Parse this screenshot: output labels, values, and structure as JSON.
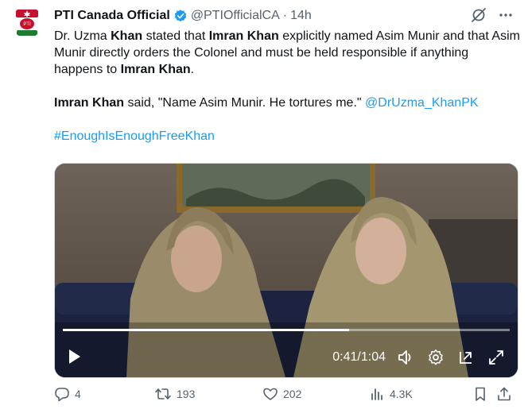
{
  "account": {
    "name": "PTI Canada Official",
    "handle": "@PTIOfficialCA",
    "separator": "·",
    "time": "14h",
    "avatar_text": "PTI Canada"
  },
  "tweet": {
    "p1": {
      "t1": "Dr. Uzma ",
      "t2": "Khan",
      "t3": " stated that ",
      "t4": "Imran Khan",
      "t5": " explicitly named Asim Munir and that Asim Munir directly orders the Colonel and must be held responsible if anything happens to ",
      "t6": "Imran Khan",
      "t7": "."
    },
    "p2": {
      "t1": "Imran Khan",
      "t2": " said, \"Name Asim Munir. He tortures me.\" ",
      "mention": "@DrUzma_KhanPK"
    },
    "p3": {
      "hashtag": "#EnoughIsEnoughFreeKhan"
    }
  },
  "video": {
    "current_time": "0:41",
    "separator": "/",
    "duration": "1:04",
    "progress": 0.6406
  },
  "actions": {
    "replies": "4",
    "reposts": "193",
    "likes": "202",
    "views": "4.3K"
  },
  "colors": {
    "link": "#1d9bf0",
    "verified": "#1d9bf0",
    "muted": "#536471",
    "text": "#0f1419",
    "pti_red": "#c8102e",
    "pti_green": "#1f7a32"
  },
  "icons": [
    "verified-badge-icon",
    "grok-icon",
    "more-icon",
    "play-icon",
    "volume-icon",
    "settings-icon",
    "pip-icon",
    "fullscreen-icon",
    "reply-icon",
    "repost-icon",
    "like-icon",
    "views-icon",
    "bookmark-icon",
    "share-icon"
  ]
}
